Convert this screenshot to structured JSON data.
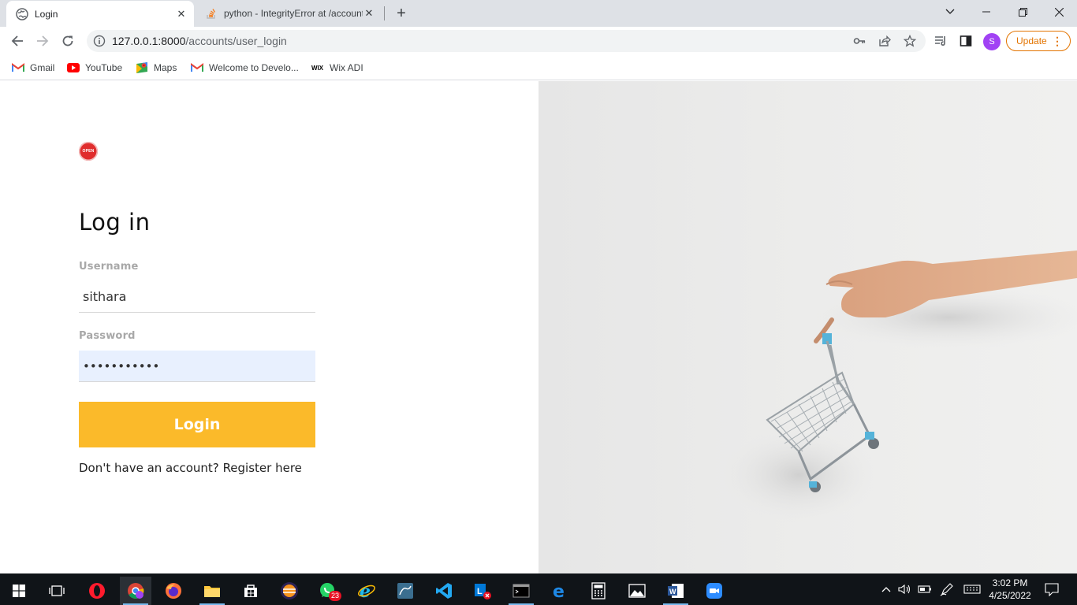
{
  "browser": {
    "tabs": [
      {
        "title": "Login",
        "icon": "globe-icon"
      },
      {
        "title": "python - IntegrityError at /accounts",
        "icon": "stackoverflow-icon"
      }
    ],
    "new_tab": "+",
    "address": {
      "host": "127.0.0.1:8000",
      "path": "/accounts/user_login"
    },
    "profile_initial": "S",
    "update_label": "Update",
    "menu_label": "⋮",
    "bookmarks": [
      {
        "label": "Gmail",
        "icon": "gmail-icon"
      },
      {
        "label": "YouTube",
        "icon": "youtube-icon"
      },
      {
        "label": "Maps",
        "icon": "maps-icon"
      },
      {
        "label": "Welcome to Develo...",
        "icon": "gmail-icon"
      },
      {
        "label": "Wix ADI",
        "icon": "wix-icon"
      }
    ]
  },
  "page": {
    "logo_text": "OPEN",
    "heading": "Log in",
    "username_label": "Username",
    "username_value": "sithara",
    "password_label": "Password",
    "password_value": "•••••••••••",
    "login_button": "Login",
    "register_prefix": "Don't have an account?",
    "register_link": "Register here",
    "hero_image": "hand holding shopping cart",
    "accent_color": "#fbba2a"
  },
  "taskbar": {
    "apps": [
      "windows-start-icon",
      "task-view-icon",
      "opera-icon",
      "chrome-icon",
      "firefox-icon",
      "file-explorer-icon",
      "store-icon",
      "eclipse-icon",
      "whatsapp-icon",
      "ie-icon",
      "mysql-icon",
      "vscode-icon",
      "lync-icon",
      "terminal-icon",
      "edge-icon",
      "calculator-icon",
      "photos-icon",
      "word-icon",
      "zoom-icon"
    ],
    "whatsapp_badge": "23",
    "time": "3:02 PM",
    "date": "4/25/2022"
  }
}
